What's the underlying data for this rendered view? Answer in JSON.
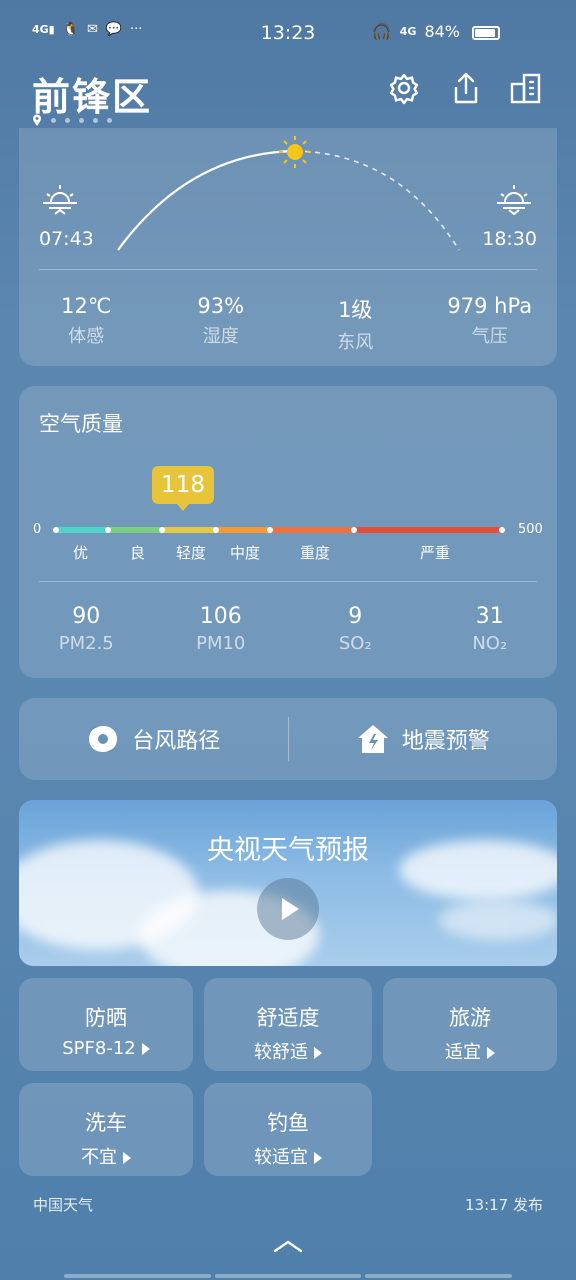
{
  "status_bar": {
    "left_icons": "4G",
    "time": "13:23",
    "net": "4G",
    "battery": "84%"
  },
  "header": {
    "city": "前锋区",
    "page_count": 6
  },
  "sun": {
    "sunrise": "07:43",
    "sunset": "18:30",
    "stats": [
      {
        "value": "12℃",
        "label": "体感"
      },
      {
        "value": "93%",
        "label": "湿度"
      },
      {
        "value": "1级",
        "label": "东风"
      },
      {
        "value": "979 hPa",
        "label": "气压"
      }
    ]
  },
  "air_quality": {
    "title": "空气质量",
    "aqi": "118",
    "aqi_value": 118,
    "scale_min": "0",
    "scale_max": "500",
    "levels": [
      "优",
      "良",
      "轻度",
      "中度",
      "重度",
      "严重"
    ],
    "pollutants": [
      {
        "value": "90",
        "label": "PM2.5"
      },
      {
        "value": "106",
        "label": "PM10"
      },
      {
        "value": "9",
        "label": "SO₂"
      },
      {
        "value": "31",
        "label": "NO₂"
      }
    ]
  },
  "links": {
    "typhoon": "台风路径",
    "earthquake": "地震预警"
  },
  "video": {
    "title": "央视天气预报"
  },
  "indices": [
    {
      "title": "防晒",
      "value": "SPF8-12"
    },
    {
      "title": "舒适度",
      "value": "较舒适"
    },
    {
      "title": "旅游",
      "value": "适宜"
    },
    {
      "title": "洗车",
      "value": "不宜"
    },
    {
      "title": "钓鱼",
      "value": "较适宜"
    }
  ],
  "footer": {
    "source": "中国天气",
    "published": "13:17 发布"
  },
  "colors": {
    "aqi_badge": "#e8c43a",
    "sun": "#f5c518"
  }
}
